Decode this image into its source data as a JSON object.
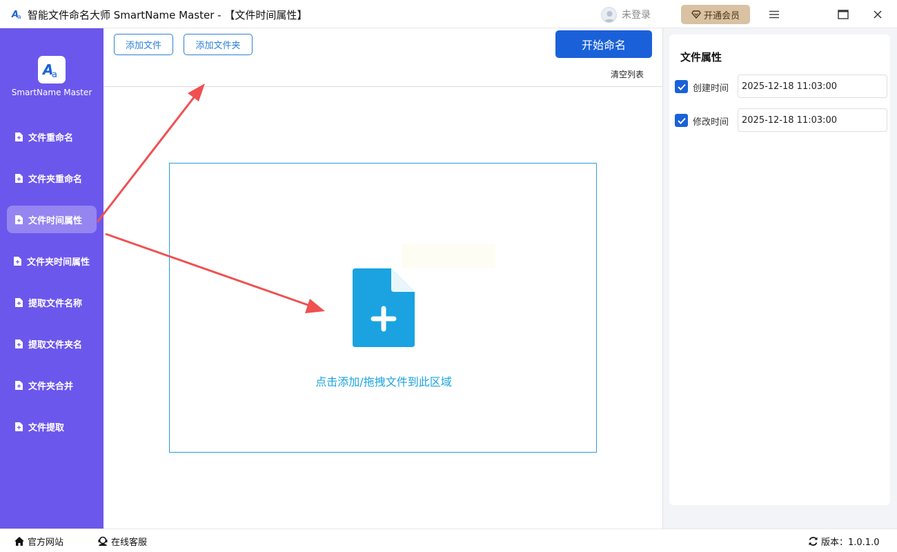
{
  "window": {
    "title": "智能文件命名大师 SmartName Master - 【文件时间属性】",
    "user_label": "未登录",
    "vip_label": "开通会员"
  },
  "sidebar": {
    "brand": "SmartName Master",
    "items": [
      {
        "label": "文件重命名",
        "active": false
      },
      {
        "label": "文件夹重命名",
        "active": false
      },
      {
        "label": "文件时间属性",
        "active": true
      },
      {
        "label": "文件夹时间属性",
        "active": false
      },
      {
        "label": "提取文件名称",
        "active": false
      },
      {
        "label": "提取文件夹名",
        "active": false
      },
      {
        "label": "文件夹合并",
        "active": false
      },
      {
        "label": "文件提取",
        "active": false
      }
    ]
  },
  "toolbar": {
    "add_file": "添加文件",
    "add_folder": "添加文件夹",
    "start": "开始命名",
    "clear": "清空列表"
  },
  "dropzone": {
    "hint": "点击添加/拖拽文件到此区域"
  },
  "panel": {
    "title": "文件属性",
    "rows": [
      {
        "label": "创建时间",
        "checked": true,
        "value": "2025-12-18 11:03:00"
      },
      {
        "label": "修改时间",
        "checked": true,
        "value": "2025-12-18 11:03:00"
      }
    ]
  },
  "footer": {
    "website": "官方网站",
    "support": "在线客服",
    "version": "版本：1.0.1.0"
  },
  "colors": {
    "sidebar": "#6c57ec",
    "primary": "#1a61d9",
    "accent": "#1aa3e0",
    "annotation_arrow": "#f05050"
  },
  "icons": [
    "app-logo-icon",
    "avatar-icon",
    "diamond-icon",
    "menu-icon",
    "maximize-icon",
    "close-icon",
    "file-icon",
    "file-add-icon",
    "checkbox-checked-icon",
    "home-icon",
    "support-icon",
    "refresh-icon"
  ]
}
